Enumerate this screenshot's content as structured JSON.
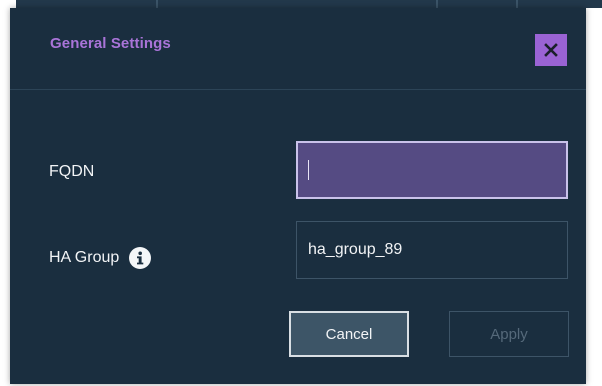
{
  "dialog": {
    "title": "General Settings",
    "close_icon": "close-icon",
    "fields": {
      "fqdn": {
        "label": "FQDN",
        "value": "",
        "focused": true
      },
      "ha_group": {
        "label": "HA Group",
        "value": "ha_group_89",
        "info_icon": "info-icon"
      }
    },
    "buttons": {
      "cancel": "Cancel",
      "apply": "Apply",
      "apply_disabled": true
    }
  },
  "colors": {
    "dialog_background": "#1a2e3f",
    "title": "#a974d8",
    "close_button": "#9a63d4",
    "focused_input": "#554b83",
    "focused_border": "#c9c2ea",
    "cancel_button": "#3d5567",
    "disabled_text": "#55697a"
  }
}
